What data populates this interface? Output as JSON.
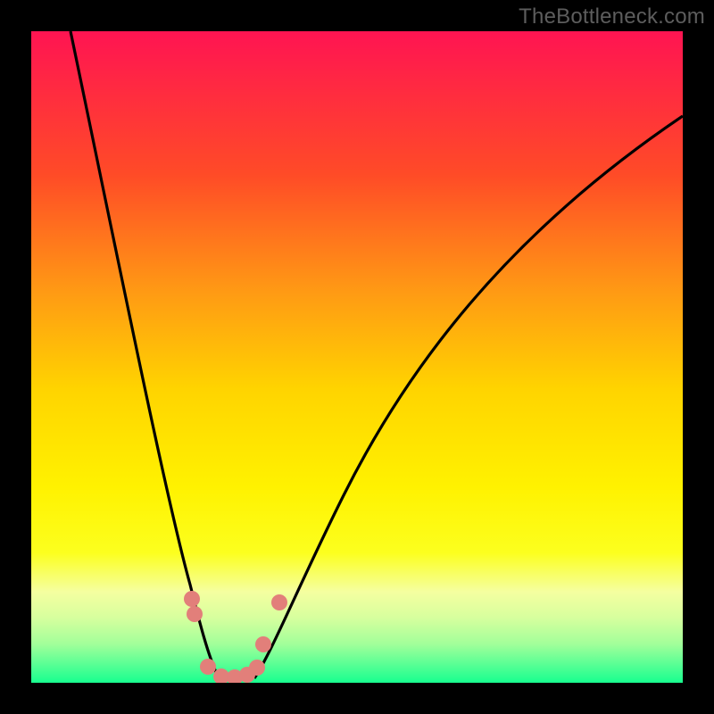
{
  "watermark": "TheBottleneck.com",
  "chart_data": {
    "type": "line",
    "title": "",
    "xlabel": "",
    "ylabel": "",
    "xlim": [
      0,
      100
    ],
    "ylim": [
      0,
      100
    ],
    "background": {
      "type": "vertical_gradient",
      "stops": [
        {
          "pos": 0.0,
          "color": "#ff1452"
        },
        {
          "pos": 0.22,
          "color": "#ff4b27"
        },
        {
          "pos": 0.4,
          "color": "#ff9a14"
        },
        {
          "pos": 0.55,
          "color": "#ffd400"
        },
        {
          "pos": 0.7,
          "color": "#fff200"
        },
        {
          "pos": 0.8,
          "color": "#fcff1e"
        },
        {
          "pos": 0.86,
          "color": "#f5ffa0"
        },
        {
          "pos": 0.9,
          "color": "#d7ff9e"
        },
        {
          "pos": 0.94,
          "color": "#a3ff9a"
        },
        {
          "pos": 0.97,
          "color": "#5dff95"
        },
        {
          "pos": 1.0,
          "color": "#18ff8f"
        }
      ]
    },
    "series": [
      {
        "name": "left-branch",
        "style": "solid-black",
        "x": [
          6,
          8,
          10,
          12,
          14,
          16,
          18,
          20,
          22,
          24,
          25,
          26,
          27,
          28
        ],
        "y": [
          100,
          90,
          80,
          70,
          60,
          50,
          40,
          30,
          20,
          10,
          6,
          3,
          1,
          0
        ]
      },
      {
        "name": "right-branch",
        "style": "solid-black",
        "x": [
          34,
          36,
          38,
          42,
          46,
          52,
          60,
          70,
          80,
          90,
          100
        ],
        "y": [
          0,
          3,
          8,
          18,
          28,
          40,
          53,
          65,
          75,
          82,
          87
        ]
      },
      {
        "name": "trough-dots",
        "style": "pink-dots",
        "x": [
          24.5,
          25,
          27,
          29,
          31,
          33,
          34.5,
          35.5,
          38
        ],
        "y": [
          13,
          10,
          2,
          0.5,
          0.5,
          1,
          2,
          6,
          12
        ]
      }
    ],
    "colors": {
      "curve": "#000000",
      "dots": "#e27f7a",
      "frame": "#000000"
    }
  }
}
